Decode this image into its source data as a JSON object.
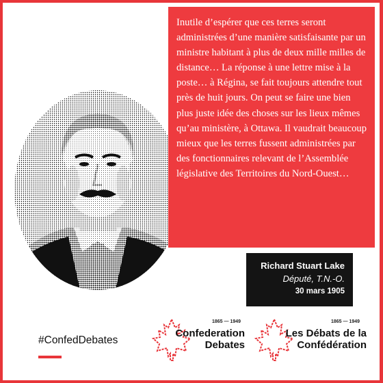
{
  "quote": {
    "text": "Inutile d’espérer que ces terres seront administrées d’une manière satisfaisante par un ministre habitant à plus de deux mille milles de distance… La réponse à une lettre mise à la poste… à Régina, se fait toujours attendre tout près de huit jours. On peut se faire une bien plus juste idée des choses sur les lieux mêmes qu’au ministère, à Ottawa. Il vaudrait beaucoup mieux que les terres fussent administrées par des fonctionnaires relevant de l’Assemblée législative des Territoires du Nord-Ouest…"
  },
  "attribution": {
    "name": "Richard Stuart Lake",
    "role": "Député, T.N.-O.",
    "date": "30 mars 1905"
  },
  "hashtag": "#ConfedDebates",
  "logos": [
    {
      "years": "1865 — 1949",
      "line1": "Confederation",
      "line2": "Debates"
    },
    {
      "years": "1865 — 1949",
      "line1": "Les Débats de la",
      "line2": "Confédération"
    }
  ],
  "colors": {
    "accent": "#e8353a",
    "quote_bg": "#ee3b3f",
    "attrib_bg": "#141414"
  }
}
